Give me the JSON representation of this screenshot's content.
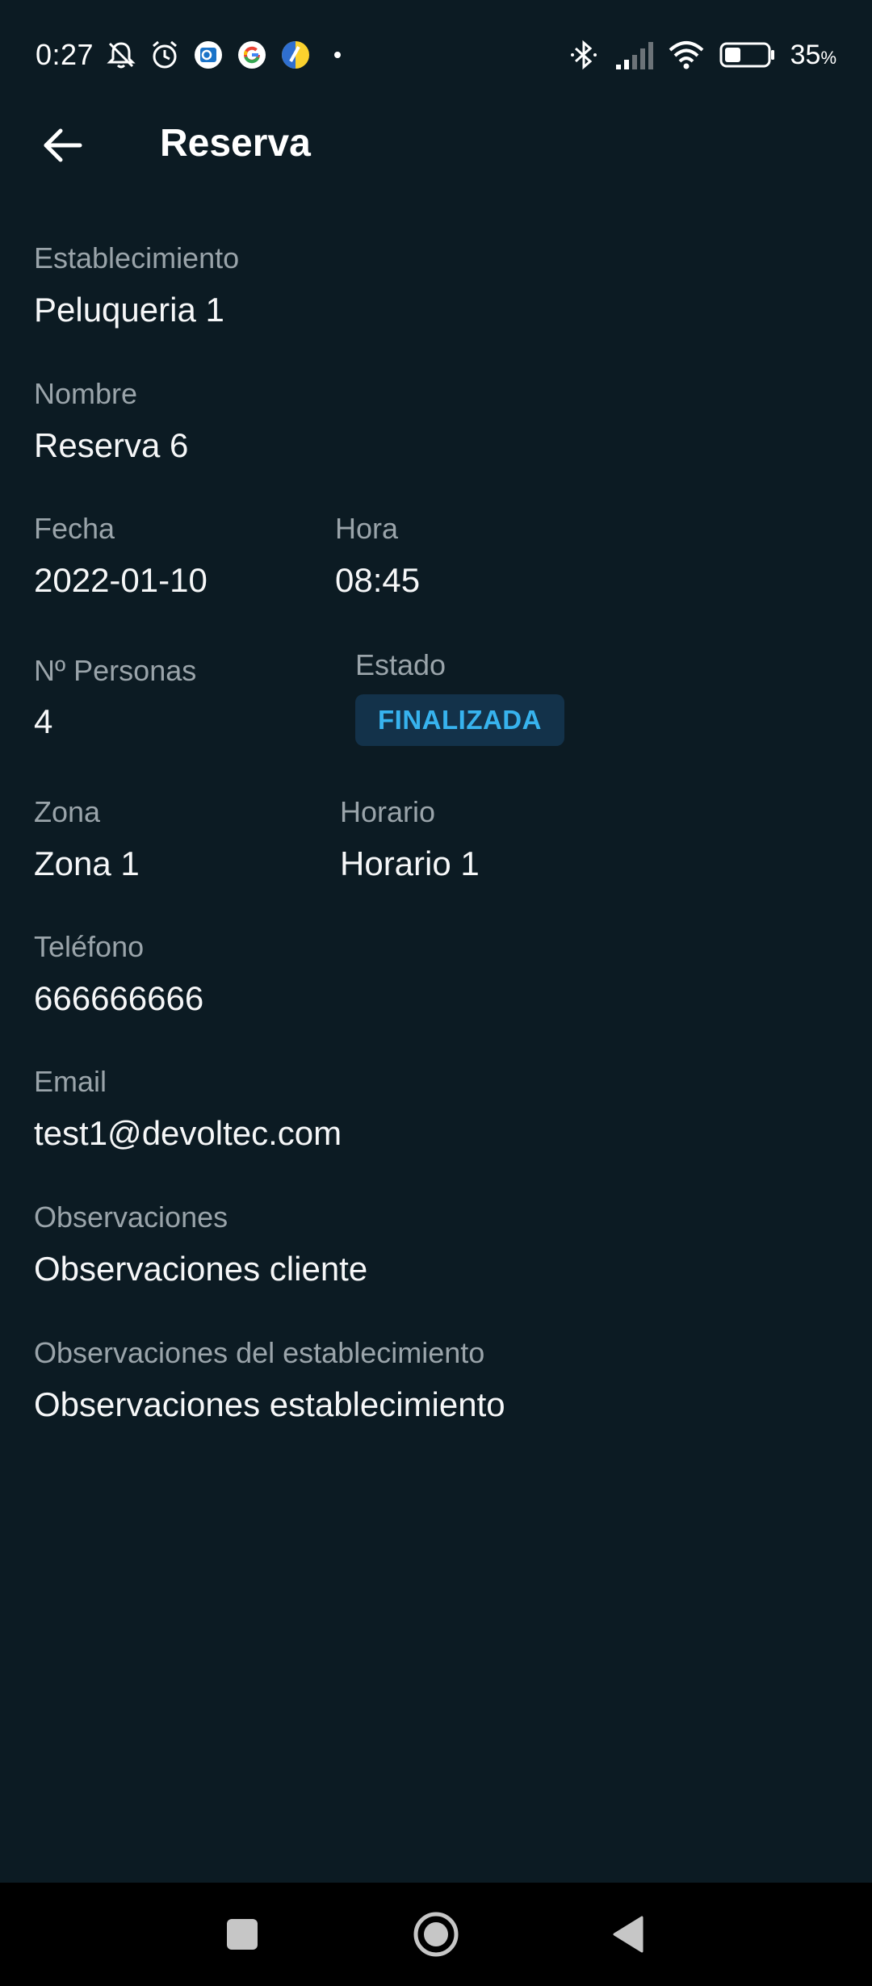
{
  "status_bar": {
    "time": "0:27",
    "battery_value": "35",
    "battery_unit": "%",
    "left_icons": [
      "muted-bell-icon",
      "alarm-icon",
      "outlook-icon",
      "google-icon",
      "lemon-app-icon"
    ],
    "right_icons": [
      "bluetooth-icon",
      "signal-icon",
      "wifi-icon",
      "battery-icon"
    ]
  },
  "app_bar": {
    "title": "Reserva",
    "back_icon": "arrow-left-icon"
  },
  "fields": {
    "establecimiento": {
      "label": "Establecimiento",
      "value": "Peluqueria 1"
    },
    "nombre": {
      "label": "Nombre",
      "value": "Reserva 6"
    },
    "fecha": {
      "label": "Fecha",
      "value": "2022-01-10"
    },
    "hora": {
      "label": "Hora",
      "value": "08:45"
    },
    "personas": {
      "label": "Nº Personas",
      "value": "4"
    },
    "estado": {
      "label": "Estado",
      "value": "FINALIZADA"
    },
    "zona": {
      "label": "Zona",
      "value": "Zona 1"
    },
    "horario": {
      "label": "Horario",
      "value": "Horario 1"
    },
    "telefono": {
      "label": "Teléfono",
      "value": "666666666"
    },
    "email": {
      "label": "Email",
      "value": "test1@devoltec.com"
    },
    "observaciones": {
      "label": "Observaciones",
      "value": "Observaciones cliente"
    },
    "observaciones_est": {
      "label": "Observaciones del establecimiento",
      "value": "Observaciones establecimiento"
    }
  },
  "colors": {
    "background": "#0c1b23",
    "label": "#9aa4aa",
    "value": "#f6f7f8",
    "badge_bg": "#13324a",
    "badge_text": "#37b3ee",
    "nav_bar": "#000000"
  },
  "nav_bar": {
    "icons": [
      "recents-square-icon",
      "home-circle-icon",
      "back-triangle-icon"
    ]
  }
}
